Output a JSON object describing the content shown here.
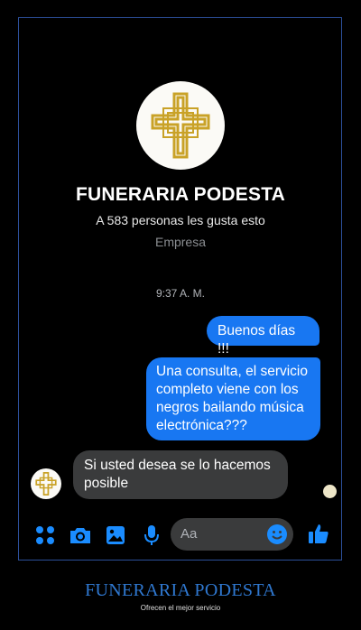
{
  "profile": {
    "name": "FUNERARIA PODESTA",
    "likes": "A 583 personas les gusta esto",
    "category": "Empresa",
    "avatar_icon": "gold-cross-logo-icon"
  },
  "chat": {
    "timestamp": "9:37 A. M.",
    "messages": [
      {
        "direction": "outgoing",
        "text": "Buenos días !!!"
      },
      {
        "direction": "outgoing",
        "text": "Una consulta, el servicio completo viene con los negros bailando música electrónica???"
      },
      {
        "direction": "incoming",
        "text": "Si usted desea se lo hacemos posible"
      }
    ]
  },
  "composer": {
    "placeholder": "Aa",
    "icons": [
      "menu-dots-icon",
      "camera-icon",
      "gallery-icon",
      "microphone-icon",
      "emoji-icon",
      "thumbs-up-icon"
    ]
  },
  "caption": {
    "title": "FUNERARIA PODESTA",
    "subtitle": "Ofrecen el mejor servicio"
  },
  "colors": {
    "accent": "#1877f2",
    "incoming_bubble": "#3a3b3c",
    "frame_border": "#2c4f9a",
    "logo_gold": "#c9a227"
  }
}
